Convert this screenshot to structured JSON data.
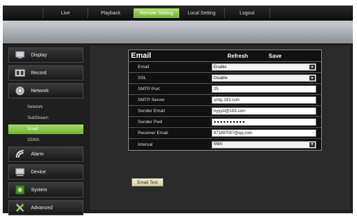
{
  "nav": {
    "tabs": [
      {
        "label": "Live"
      },
      {
        "label": "Playback"
      },
      {
        "label": "Remote Setting"
      },
      {
        "label": "Local Setting"
      },
      {
        "label": "Logout"
      }
    ],
    "active_index": 2
  },
  "sidebar": {
    "display": "Display",
    "record": "Record",
    "network": "Network",
    "sub": {
      "network": "Network",
      "substream": "SubStream",
      "email": "Email",
      "ddns": "DDNS"
    },
    "alarm": "Alarm",
    "device": "Device",
    "system": "System",
    "advanced": "Advanced"
  },
  "form": {
    "title": "Email",
    "refresh": "Refresh",
    "save": "Save",
    "rows": [
      {
        "label": "Email",
        "value": "Enable"
      },
      {
        "label": "SSL",
        "value": "Disable"
      },
      {
        "label": "SMTP Port",
        "value": "25"
      },
      {
        "label": "SMTP Server",
        "value": "smtp.163.com"
      },
      {
        "label": "Sender Email",
        "value": "hyyyzt@163.com"
      },
      {
        "label": "Sender Pwd",
        "value": "●●●●●●●●●●"
      },
      {
        "label": "Receiver Email",
        "value": "871897057@qq.com"
      },
      {
        "label": "Interval",
        "value": "5Min"
      }
    ]
  },
  "email_test": "Email Test",
  "colors": {
    "accent": "#7cc23a",
    "background": "#1f1f1f"
  }
}
